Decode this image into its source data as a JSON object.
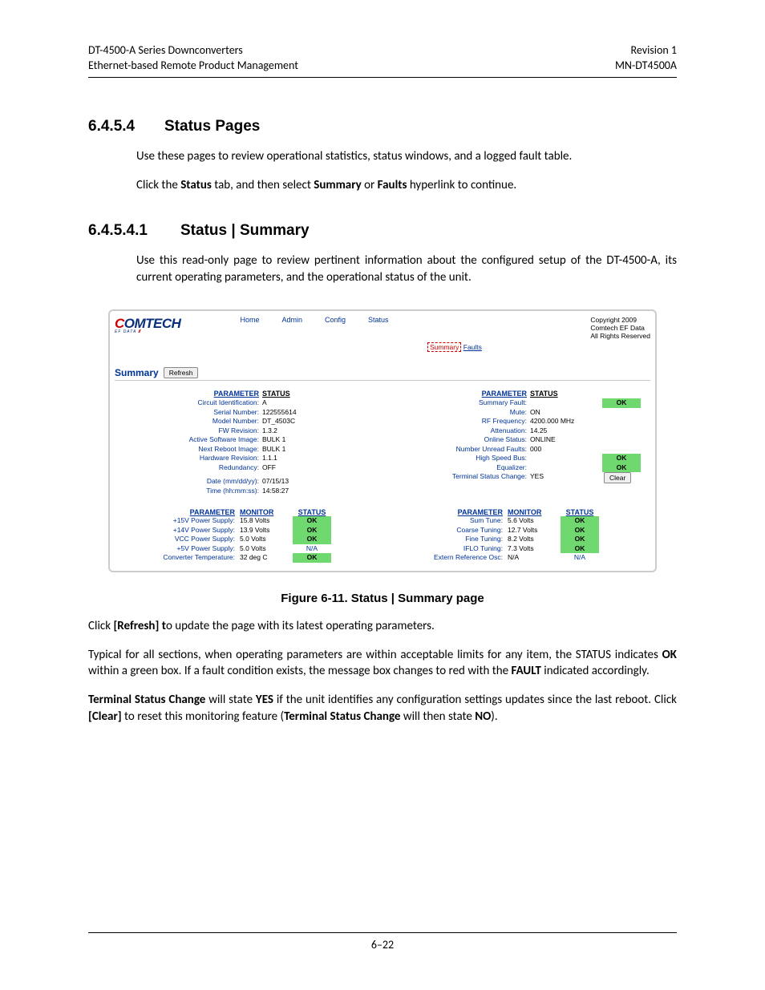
{
  "header": {
    "left": "DT-4500-A Series Downconverters\nEthernet-based Remote Product Management",
    "right": "Revision 1\nMN-DT4500A"
  },
  "section1": {
    "num": "6.4.5.4",
    "title": "Status Pages"
  },
  "p1": "Use these pages to review operational statistics, status windows, and a logged fault table.",
  "p2_a": "Click the ",
  "p2_b": "Status",
  "p2_c": " tab, and then select ",
  "p2_d": "Summary",
  "p2_e": " or ",
  "p2_f": "Faults",
  "p2_g": " hyperlink to continue.",
  "section2": {
    "num": "6.4.5.4.1",
    "title": "Status | Summary"
  },
  "p3": "Use this read-only page to review pertinent information about the configured setup of the DT-4500-A, its current operating parameters, and the operational status of the unit.",
  "fig": {
    "brand": "OMTECH",
    "brand_sub": "EF DATA ",
    "copyright": "Copyright 2009\nComtech EF Data\nAll Rights Reserved",
    "tabs": {
      "home": "Home",
      "admin": "Admin",
      "config": "Config",
      "status": "Status"
    },
    "subtabs": {
      "summary": "Summary",
      "faults": "Faults"
    },
    "summary_label": "Summary",
    "refresh": "Refresh",
    "ps_header": {
      "param": "PARAMETER",
      "status": "STATUS"
    },
    "left_params": [
      {
        "k": "Circuit Identification:",
        "v": "A"
      },
      {
        "k": "Serial Number:",
        "v": "122555614"
      },
      {
        "k": "Model Number:",
        "v": "DT_4503C"
      },
      {
        "k": "FW Revision:",
        "v": "1.3.2"
      },
      {
        "k": "Active Software Image:",
        "v": "BULK 1"
      },
      {
        "k": "Next Reboot Image:",
        "v": "BULK 1"
      },
      {
        "k": "Hardware Revision:",
        "v": "1.1.1"
      },
      {
        "k": "Redundancy:",
        "v": "OFF"
      },
      {
        "k": "Date (mm/dd/yy):",
        "v": "07/15/13"
      },
      {
        "k": "Time (hh:mm:ss):",
        "v": "14:58:27"
      }
    ],
    "right_params": [
      {
        "k": "Summary Fault:",
        "v": "",
        "pill": "OK"
      },
      {
        "k": "Mute:",
        "v": "ON"
      },
      {
        "k": "RF Frequency:",
        "v": "4200.000 MHz"
      },
      {
        "k": "Attenuation:",
        "v": "14.25"
      },
      {
        "k": "Online Status:",
        "v": "ONLINE"
      },
      {
        "k": "Number Unread Faults:",
        "v": "000"
      },
      {
        "k": "High Speed Bus:",
        "v": "",
        "pill": "OK"
      },
      {
        "k": "Equalizer:",
        "v": "",
        "pill": "OK"
      },
      {
        "k": "Terminal Status Change:",
        "v": "YES",
        "btn": "Clear"
      }
    ],
    "mon_header": {
      "param": "PARAMETER",
      "mon": "MONITOR",
      "status": "STATUS"
    },
    "left_mon": [
      {
        "p": "+15V Power Supply:",
        "m": "15.8 Volts",
        "s": "OK",
        "ok": true
      },
      {
        "p": "+14V Power Supply:",
        "m": "13.9 Volts",
        "s": "OK",
        "ok": true
      },
      {
        "p": "VCC Power Supply:",
        "m": "5.0 Volts",
        "s": "OK",
        "ok": true
      },
      {
        "p": "+5V Power Supply:",
        "m": "5.0 Volts",
        "s": "N/A",
        "ok": false
      },
      {
        "p": "Converter Temperature:",
        "m": "32 deg C",
        "s": "OK",
        "ok": true
      }
    ],
    "right_mon": [
      {
        "p": "Sum Tune:",
        "m": "5.6 Volts",
        "s": "OK",
        "ok": true
      },
      {
        "p": "Coarse Tuning:",
        "m": "12.7 Volts",
        "s": "OK",
        "ok": true
      },
      {
        "p": "Fine Tuning:",
        "m": "8.2 Volts",
        "s": "OK",
        "ok": true
      },
      {
        "p": "IFLO Tuning:",
        "m": "7.3 Volts",
        "s": "OK",
        "ok": true
      },
      {
        "p": "Extern Reference Osc:",
        "m": "N/A",
        "s": "N/A",
        "ok": false
      }
    ]
  },
  "caption": "Figure 6-11. Status | Summary page",
  "p4_a": "Click ",
  "p4_b": "[Refresh] t",
  "p4_c": "o update the page with its latest operating parameters.",
  "p5_a": "Typical for all sections, when operating parameters are within acceptable limits for any item, the STATUS indicates ",
  "p5_b": "OK",
  "p5_c": " within a green box. If a fault condition exists, the message box changes to red with the ",
  "p5_d": "FAULT",
  "p5_e": " indicated accordingly.",
  "p6_a": "Terminal Status Change",
  "p6_b": " will state ",
  "p6_c": "YES",
  "p6_d": " if the unit identifies any configuration settings updates since the last reboot. Click ",
  "p6_e": "[Clear]",
  "p6_f": " to reset this monitoring feature (",
  "p6_g": "Terminal Status Change",
  "p6_h": " will then state ",
  "p6_i": "NO",
  "p6_j": ").",
  "page_num": "6–22"
}
